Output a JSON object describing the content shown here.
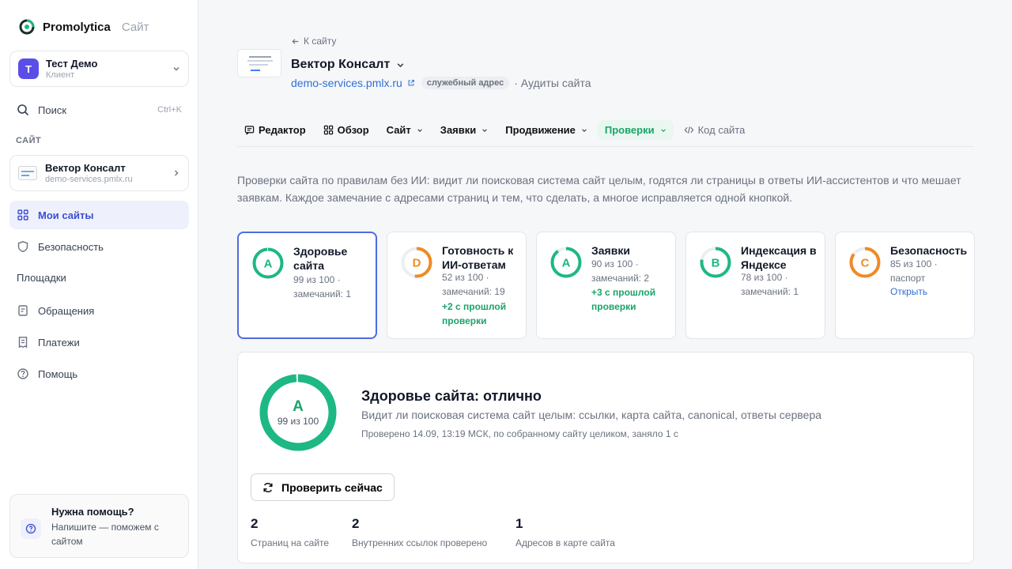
{
  "brand": {
    "name": "Promolytica",
    "suffix": "Сайт"
  },
  "account": {
    "avatar": "Т",
    "name": "Тест Демо",
    "role": "Клиент"
  },
  "search": {
    "label": "Поиск",
    "shortcut": "Ctrl+K"
  },
  "sidebar": {
    "section_caption": "САЙТ",
    "site": {
      "name": "Вектор Консалт",
      "url": "demo-services.pmlx.ru"
    },
    "items": [
      {
        "label": "Мои сайты",
        "icon": "grid-icon",
        "active": true
      },
      {
        "label": "Безопасность",
        "icon": "shield-icon"
      },
      {
        "label": "Площадки"
      },
      {
        "label": "Обращения",
        "icon": "message-icon"
      },
      {
        "label": "Платежи",
        "icon": "receipt-icon"
      },
      {
        "label": "Помощь",
        "icon": "help-icon"
      }
    ],
    "help": {
      "title": "Нужна помощь?",
      "text": "Напишите — поможем с сайтом"
    }
  },
  "header": {
    "back": "К сайту",
    "title": "Вектор Консалт",
    "url": "demo-services.pmlx.ru",
    "badge": "служебный адрес",
    "audits": "· Аудиты сайта"
  },
  "tabs": [
    {
      "label": "Редактор",
      "icon": "editor-icon"
    },
    {
      "label": "Обзор",
      "icon": "overview-icon"
    },
    {
      "label": "Сайт",
      "dropdown": true
    },
    {
      "label": "Заявки",
      "dropdown": true
    },
    {
      "label": "Продвижение",
      "dropdown": true
    },
    {
      "label": "Проверки",
      "dropdown": true,
      "active": true
    },
    {
      "label": "Код сайта",
      "icon": "code-icon",
      "muted": true
    }
  ],
  "intro": "Проверки сайта по правилам без ИИ: видит ли поисковая система сайт целым, годятся ли страницы в ответы ИИ-ассистентов и что мешает заявкам. Каждое замечание с адресами страниц и тем, что сделать, а многое исправляется одной кнопкой.",
  "cards": [
    {
      "grade": "A",
      "title": "Здоровье сайта",
      "score": "99 из 100 ·",
      "issues": "замечаний: 1",
      "delta": "",
      "link": "",
      "value": 99,
      "color": "#1db883",
      "selected": true
    },
    {
      "grade": "D",
      "title": "Готовность к ИИ-ответам",
      "score": "52 из 100 ·",
      "issues": "замечаний: 19",
      "delta": "+2 с прошлой проверки",
      "link": "",
      "value": 52,
      "color": "#f08a24"
    },
    {
      "grade": "A",
      "title": "Заявки",
      "score": "90 из 100 ·",
      "issues": "замечаний: 2",
      "delta": "+3 с прошлой проверки",
      "link": "",
      "value": 90,
      "color": "#1db883"
    },
    {
      "grade": "B",
      "title": "Индексация в Яндексе",
      "score": "78 из 100 ·",
      "issues": "замечаний: 1",
      "delta": "",
      "link": "",
      "value": 78,
      "color": "#1db883"
    },
    {
      "grade": "C",
      "title": "Безопасность",
      "score": "85 из 100 ·",
      "issues": "паспорт",
      "delta": "",
      "link": "Открыть",
      "value": 85,
      "color": "#f08a24"
    }
  ],
  "panel": {
    "grade": "A",
    "score": "99 из 100",
    "value": 99,
    "title": "Здоровье сайта: отлично",
    "desc": "Видит ли поисковая система сайт целым: ссылки, карта сайта, canonical, ответы сервера",
    "note": "Проверено 14.09, 13:19 МСК, по собранному сайту целиком, заняло 1 с",
    "button": "Проверить сейчас",
    "stats": [
      {
        "value": "2",
        "label": "Страниц на сайте"
      },
      {
        "value": "2",
        "label": "Внутренних ссылок проверено"
      },
      {
        "value": "1",
        "label": "Адресов в карте сайта"
      }
    ]
  }
}
